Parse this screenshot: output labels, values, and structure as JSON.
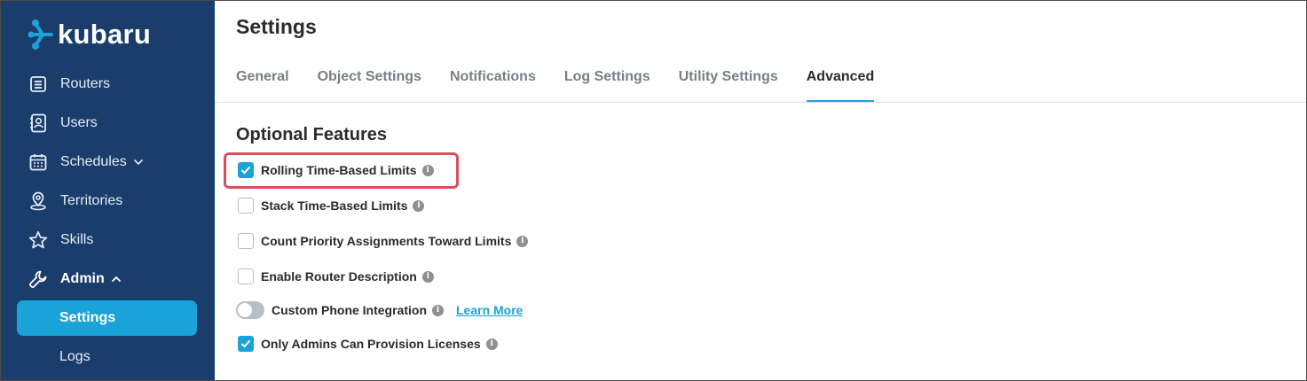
{
  "brand": {
    "name": "kubaru",
    "accent": "#1aa3d9",
    "sidebar_bg": "#1a3d6b"
  },
  "sidebar": {
    "items": [
      {
        "label": "Routers",
        "icon": "list-icon"
      },
      {
        "label": "Users",
        "icon": "contacts-icon"
      },
      {
        "label": "Schedules",
        "icon": "calendar-icon",
        "expandable": "chevron-down-icon"
      },
      {
        "label": "Territories",
        "icon": "map-pin-icon"
      },
      {
        "label": "Skills",
        "icon": "star-icon"
      },
      {
        "label": "Admin",
        "icon": "wrench-icon",
        "expandable": "chevron-up-icon"
      }
    ],
    "subitems": [
      {
        "label": "Settings",
        "active": true
      },
      {
        "label": "Logs",
        "active": false
      }
    ]
  },
  "page": {
    "title": "Settings"
  },
  "tabs": [
    {
      "label": "General"
    },
    {
      "label": "Object Settings"
    },
    {
      "label": "Notifications"
    },
    {
      "label": "Log Settings"
    },
    {
      "label": "Utility Settings"
    },
    {
      "label": "Advanced",
      "active": true
    }
  ],
  "features": {
    "title": "Optional Features",
    "options": [
      {
        "label": "Rolling Time-Based Limits",
        "control": "checkbox",
        "checked": true
      },
      {
        "label": "Stack Time-Based Limits",
        "control": "checkbox",
        "checked": false
      },
      {
        "label": "Count Priority Assignments Toward Limits",
        "control": "checkbox",
        "checked": false
      },
      {
        "label": "Enable Router Description",
        "control": "checkbox",
        "checked": false
      },
      {
        "label": "Custom Phone Integration",
        "control": "toggle",
        "checked": false,
        "link": "Learn More"
      },
      {
        "label": "Only Admins Can Provision Licenses",
        "control": "checkbox",
        "checked": true
      }
    ]
  }
}
